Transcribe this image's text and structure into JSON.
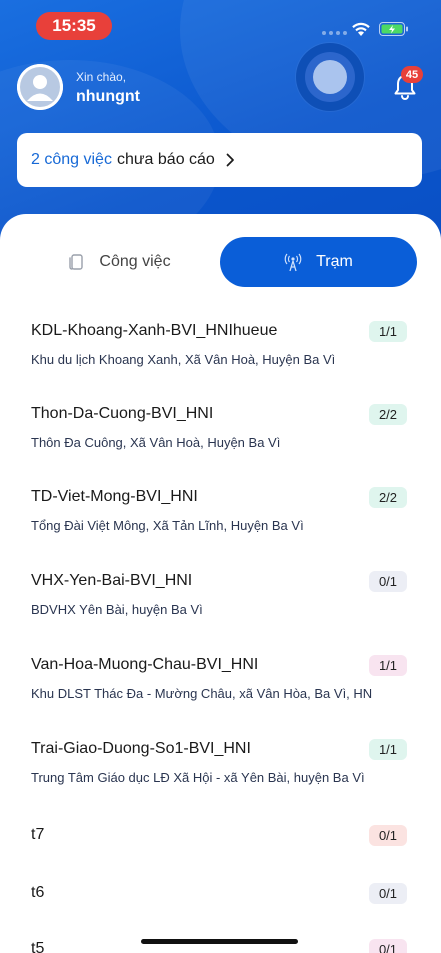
{
  "status_bar": {
    "time": "15:35"
  },
  "user": {
    "greeting": "Xin chào,",
    "name": "nhungnt"
  },
  "notifications": {
    "count": "45"
  },
  "report": {
    "count_text": "2 công việc",
    "suffix_text": "chưa báo cáo"
  },
  "tabs": [
    {
      "label": "Công việc",
      "active": false
    },
    {
      "label": "Trạm",
      "active": true
    }
  ],
  "colors": {
    "primary": "#0a5ed8",
    "badge_green": "#dff5ee",
    "badge_gray": "#eceef5",
    "badge_pink": "#f8e4f0",
    "badge_red": "#fbe3e1"
  },
  "stations": [
    {
      "name": "KDL-Khoang-Xanh-BVI_HNIhueue",
      "address": "Khu du lịch Khoang Xanh, Xã Vân Hoà, Huyện Ba Vì",
      "progress": "1/1",
      "badge": "green"
    },
    {
      "name": "Thon-Da-Cuong-BVI_HNI",
      "address": "Thôn Đa Cuông, Xã Vân Hoà, Huyện Ba Vì",
      "progress": "2/2",
      "badge": "green"
    },
    {
      "name": "TD-Viet-Mong-BVI_HNI",
      "address": "Tổng Đài Việt Mông, Xã Tản Lĩnh, Huyện Ba Vì",
      "progress": "2/2",
      "badge": "green"
    },
    {
      "name": "VHX-Yen-Bai-BVI_HNI",
      "address": "BDVHX Yên Bài, huyện Ba Vì",
      "progress": "0/1",
      "badge": "gray"
    },
    {
      "name": "Van-Hoa-Muong-Chau-BVI_HNI",
      "address": "Khu DLST Thác Đa - Mường Châu, xã Vân Hòa, Ba Vì, HN",
      "progress": "1/1",
      "badge": "pink"
    },
    {
      "name": "Trai-Giao-Duong-So1-BVI_HNI",
      "address": "Trung Tâm Giáo dục LĐ Xã Hội - xã Yên Bài, huyện Ba Vì",
      "progress": "1/1",
      "badge": "green"
    },
    {
      "name": "t7",
      "address": "",
      "progress": "0/1",
      "badge": "red"
    },
    {
      "name": "t6",
      "address": "",
      "progress": "0/1",
      "badge": "gray"
    },
    {
      "name": "t5",
      "address": "",
      "progress": "0/1",
      "badge": "pink"
    }
  ]
}
